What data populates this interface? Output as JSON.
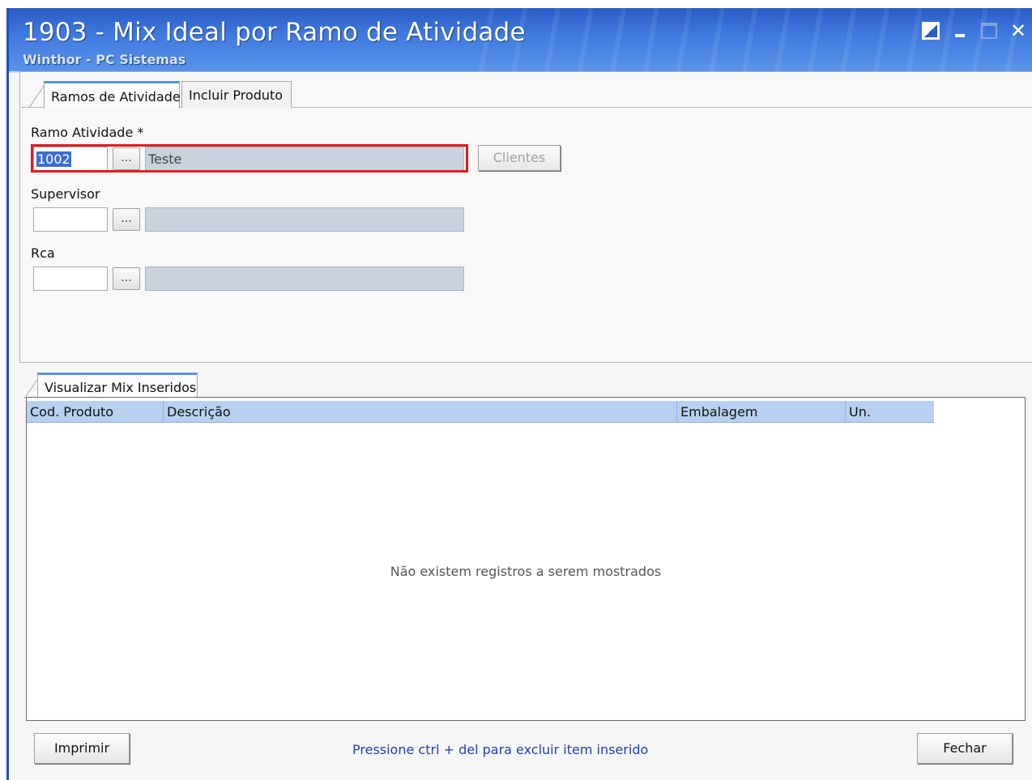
{
  "window": {
    "title": "1903 - Mix Ideal por Ramo de Atividade",
    "subtitle": "Winthor - PC Sistemas",
    "controls": [
      "restore-icon",
      "minimize-icon",
      "maximize-icon",
      "close-icon"
    ],
    "close_glyph": "✕"
  },
  "tabs": [
    {
      "label": "Ramos de Atividade",
      "active": true
    },
    {
      "label": "Incluir Produto",
      "active": false
    }
  ],
  "form": {
    "ramo": {
      "label": "Ramo Atividade *",
      "code": "1002",
      "ellipsis": "...",
      "description": "Teste"
    },
    "supervisor": {
      "label": "Supervisor",
      "code": "",
      "ellipsis": "...",
      "description": ""
    },
    "rca": {
      "label": "Rca",
      "code": "",
      "ellipsis": "...",
      "description": ""
    },
    "clientes_button": "Clientes"
  },
  "mix_tab": {
    "label": "Visualizar Mix Inseridos"
  },
  "grid": {
    "columns": [
      "Cod. Produto",
      "Descrição",
      "Embalagem",
      "Un."
    ],
    "empty_message": "Não existem registros a serem mostrados"
  },
  "footer": {
    "print_button": "Imprimir",
    "hint": "Pressione ctrl + del  para excluir item inserido",
    "close_button": "Fechar"
  },
  "colors": {
    "title_bar": "#3f78dd",
    "grid_header": "#b8d0f0",
    "highlight": "#e01b1b",
    "hint_text": "#1d3fb8"
  }
}
